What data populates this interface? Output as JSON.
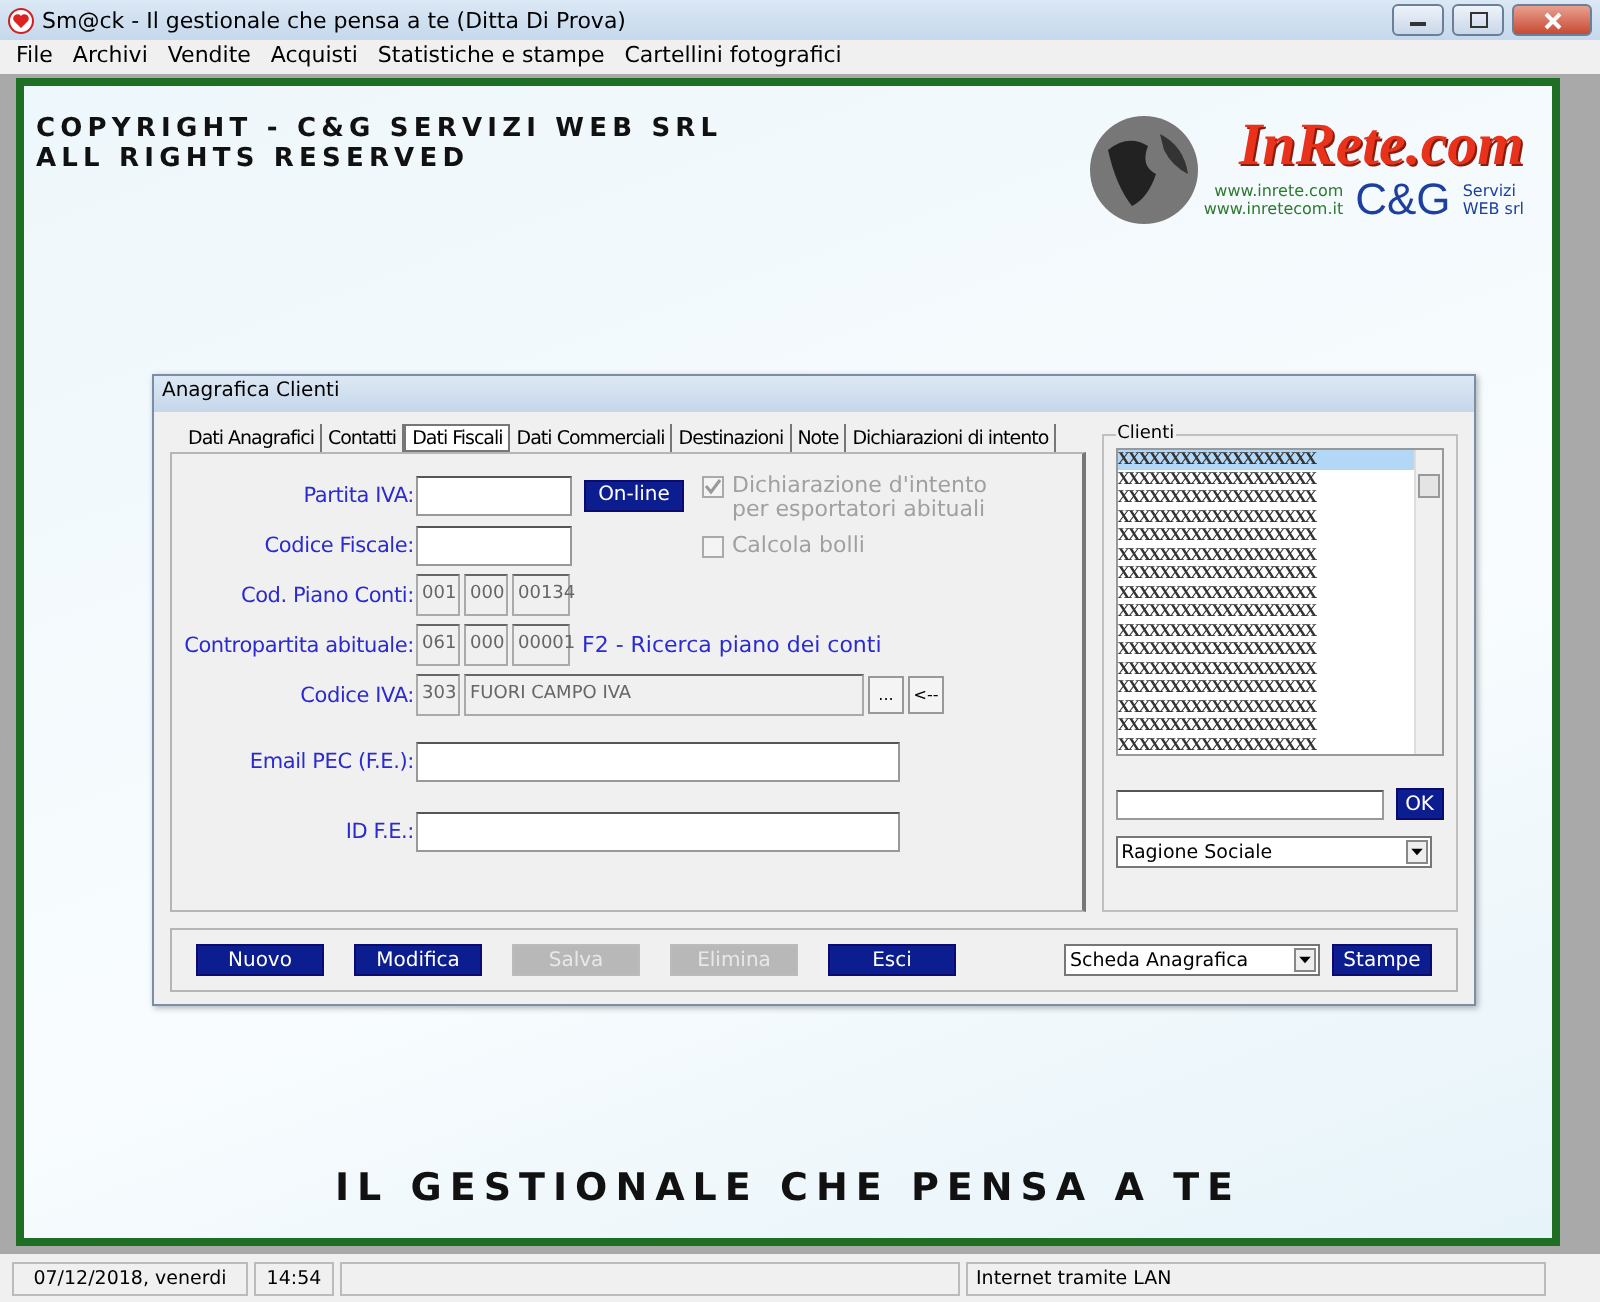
{
  "window": {
    "title": "Sm@ck - Il gestionale che pensa a te (Ditta Di Prova)"
  },
  "menu": [
    "File",
    "Archivi",
    "Vendite",
    "Acquisti",
    "Statistiche e stampe",
    "Cartellini fotografici"
  ],
  "banner": {
    "copyright": [
      "COPYRIGHT - C&G SERVIZI WEB SRL",
      "ALL RIGHTS RESERVED"
    ],
    "logo": {
      "brand": "InRete.com",
      "urls": [
        "www.inrete.com",
        "www.inretecom.it"
      ],
      "company": "C&G",
      "company_sub": [
        "Servizi",
        "WEB srl"
      ]
    },
    "slogan": "IL GESTIONALE CHE PENSA A TE"
  },
  "dialog": {
    "title": "Anagrafica Clienti",
    "tabs": [
      {
        "label": "Dati Anagrafici",
        "selected": false
      },
      {
        "label": "Contatti",
        "selected": false
      },
      {
        "label": "Dati Fiscali",
        "selected": true
      },
      {
        "label": "Dati Commerciali",
        "selected": false
      },
      {
        "label": "Destinazioni",
        "selected": false
      },
      {
        "label": "Note",
        "selected": false
      },
      {
        "label": "Dichiarazioni di intento",
        "selected": false
      }
    ],
    "fields": [
      {
        "kind": "text",
        "label": "Partita IVA:",
        "button": "On-line"
      },
      {
        "kind": "text",
        "label": "Codice Fiscale:"
      },
      {
        "kind": "account",
        "label": "Cod. Piano Conti:",
        "parts": [
          "001",
          "000",
          "00134"
        ]
      },
      {
        "kind": "account",
        "label": "Contropartita abituale:",
        "parts": [
          "061",
          "000",
          "00001"
        ],
        "hint": "F2 - Ricerca piano dei conti"
      },
      {
        "kind": "code",
        "label": "Codice IVA:",
        "code": "303",
        "description": "FUORI CAMPO IVA",
        "buttons": [
          "...",
          "<--"
        ]
      },
      {
        "kind": "wide",
        "label": "Email PEC (F.E.):"
      },
      {
        "kind": "wide",
        "label": "ID F.E.:"
      }
    ],
    "options": [
      {
        "label": "Dichiarazione d'intento\nper esportatori abituali",
        "checked": true,
        "disabled": true
      },
      {
        "label": "Calcola bolli",
        "checked": false,
        "disabled": true
      }
    ],
    "clients": {
      "title": "Clienti",
      "rows": [
        {
          "text": "XXXXXXXXXXXXXXXXXXX",
          "selected": true
        },
        {
          "text": "XXXXXXXXXXXXXXXXXXX",
          "selected": false
        },
        {
          "text": "XXXXXXXXXXXXXXXXXXX",
          "selected": false
        },
        {
          "text": "XXXXXXXXXXXXXXXXXXX",
          "selected": false
        },
        {
          "text": "XXXXXXXXXXXXXXXXXXX",
          "selected": false
        },
        {
          "text": "XXXXXXXXXXXXXXXXXXX",
          "selected": false
        },
        {
          "text": "XXXXXXXXXXXXXXXXXXX",
          "selected": false
        },
        {
          "text": "XXXXXXXXXXXXXXXXXXX",
          "selected": false
        },
        {
          "text": "XXXXXXXXXXXXXXXXXXX",
          "selected": false
        },
        {
          "text": "XXXXXXXXXXXXXXXXXXX",
          "selected": false
        },
        {
          "text": "XXXXXXXXXXXXXXXXXXX",
          "selected": false
        },
        {
          "text": "XXXXXXXXXXXXXXXXXXX",
          "selected": false
        },
        {
          "text": "XXXXXXXXXXXXXXXXXXX",
          "selected": false
        },
        {
          "text": "XXXXXXXXXXXXXXXXXXX",
          "selected": false
        },
        {
          "text": "XXXXXXXXXXXXXXXXXXX",
          "selected": false
        },
        {
          "text": "XXXXXXXXXXXXXXXXXXX",
          "selected": false
        }
      ],
      "search_button": "OK",
      "sort": "Ragione Sociale"
    },
    "buttons": [
      {
        "label": "Nuovo",
        "disabled": false
      },
      {
        "label": "Modifica",
        "disabled": false
      },
      {
        "label": "Salva",
        "disabled": true
      },
      {
        "label": "Elimina",
        "disabled": true
      },
      {
        "label": "Esci",
        "disabled": false
      }
    ],
    "report": "Scheda Anagrafica",
    "print_button": "Stampe"
  },
  "status_bar": [
    "07/12/2018, venerdi",
    "14:54",
    "Internet tramite LAN"
  ]
}
